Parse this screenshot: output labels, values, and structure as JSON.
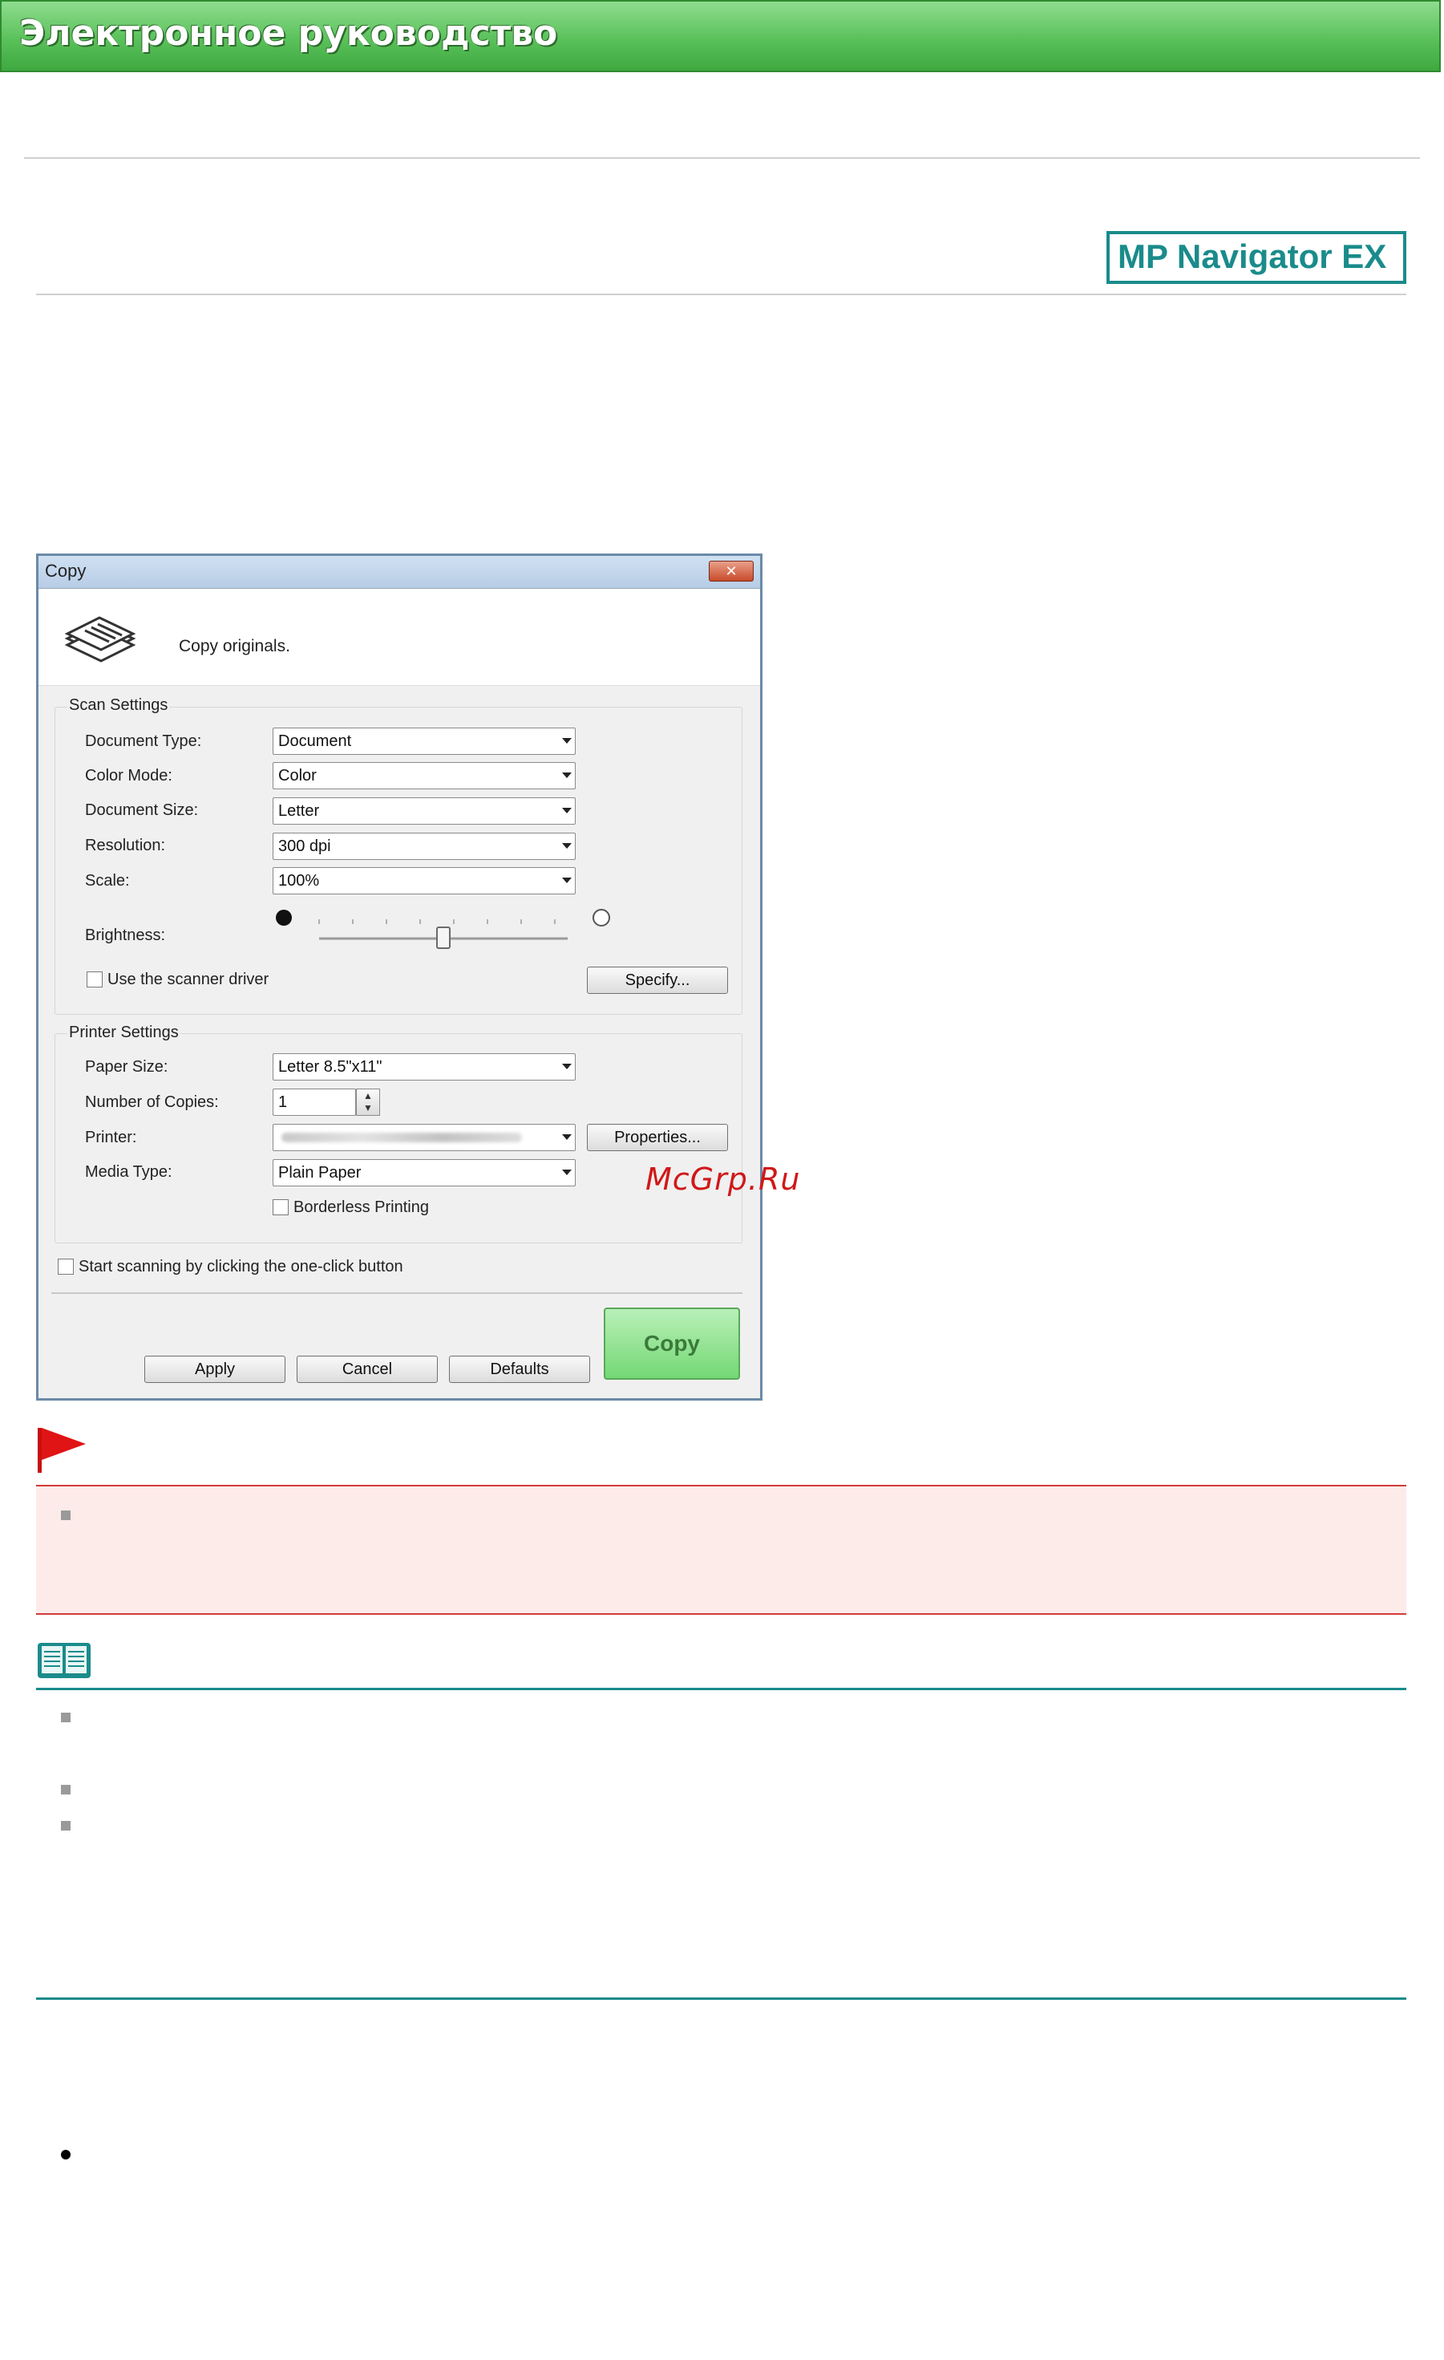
{
  "header": {
    "title": "Электронное руководство"
  },
  "product_logo": "MP Navigator EX",
  "dialog": {
    "title": "Copy",
    "close_glyph": "✕",
    "description": "Copy originals.",
    "scan_settings": {
      "group_label": "Scan Settings",
      "document_type_label": "Document Type:",
      "document_type_value": "Document",
      "color_mode_label": "Color Mode:",
      "color_mode_value": "Color",
      "document_size_label": "Document Size:",
      "document_size_value": "Letter",
      "resolution_label": "Resolution:",
      "resolution_value": "300 dpi",
      "scale_label": "Scale:",
      "scale_value": "100%",
      "brightness_label": "Brightness:",
      "brightness_level": 0.5,
      "use_scanner_driver_label": "Use the scanner driver",
      "specify_button": "Specify..."
    },
    "printer_settings": {
      "group_label": "Printer Settings",
      "paper_size_label": "Paper Size:",
      "paper_size_value": "Letter 8.5\"x11\"",
      "copies_label": "Number of Copies:",
      "copies_value": "1",
      "printer_label": "Printer:",
      "properties_button": "Properties...",
      "media_type_label": "Media Type:",
      "media_type_value": "Plain Paper",
      "borderless_label": "Borderless Printing"
    },
    "one_click_label": "Start scanning by clicking the one-click button",
    "buttons": {
      "apply": "Apply",
      "cancel": "Cancel",
      "defaults": "Defaults",
      "copy": "Copy"
    }
  },
  "watermark": "McGrp.Ru",
  "colors": {
    "banner": "#5ac15a",
    "accent_teal": "#1b8b8b",
    "important_red": "#d23a3a",
    "important_bg": "#fdebea"
  }
}
